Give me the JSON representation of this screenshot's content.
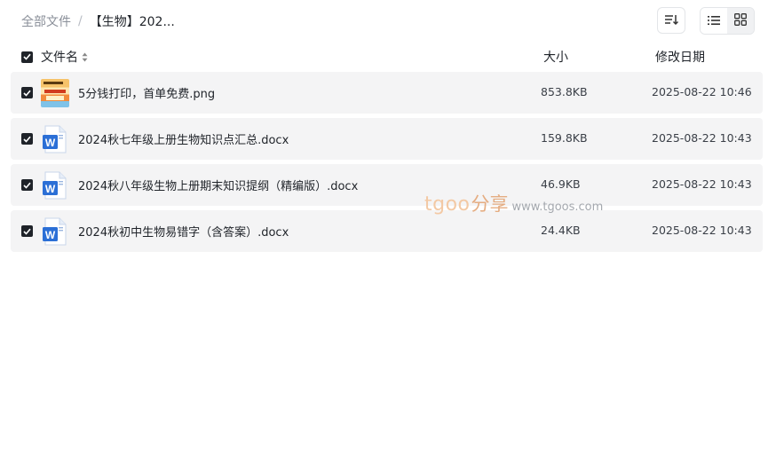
{
  "breadcrumb": {
    "root": "全部文件",
    "separator": "/",
    "current": "【生物】202..."
  },
  "toolbar": {
    "sort_icon": "sort-lines-icon",
    "list_view_icon": "list-view-icon",
    "grid_view_icon": "grid-view-icon"
  },
  "columns": {
    "name": "文件名",
    "size": "大小",
    "date": "修改日期"
  },
  "files": [
    {
      "name": "5分钱打印，首单免费.png",
      "size": "853.8KB",
      "date": "2025-08-22 10:46",
      "icon": "image-thumbnail",
      "checked": true
    },
    {
      "name": "2024秋七年级上册生物知识点汇总.docx",
      "size": "159.8KB",
      "date": "2025-08-22 10:43",
      "icon": "word-doc-icon",
      "checked": true
    },
    {
      "name": "2024秋八年级生物上册期末知识提纲（精编版）.docx",
      "size": "46.9KB",
      "date": "2025-08-22 10:43",
      "icon": "word-doc-icon",
      "checked": true
    },
    {
      "name": "2024秋初中生物易错字（含答案）.docx",
      "size": "24.4KB",
      "date": "2025-08-22 10:43",
      "icon": "word-doc-icon",
      "checked": true
    }
  ],
  "watermark": {
    "brand": "tgoo",
    "cn": "分享",
    "url": "www.tgoos.com"
  },
  "colors": {
    "row_bg": "#f4f4f5",
    "checkbox": "#1f2329",
    "word_blue": "#2b6fd6"
  }
}
